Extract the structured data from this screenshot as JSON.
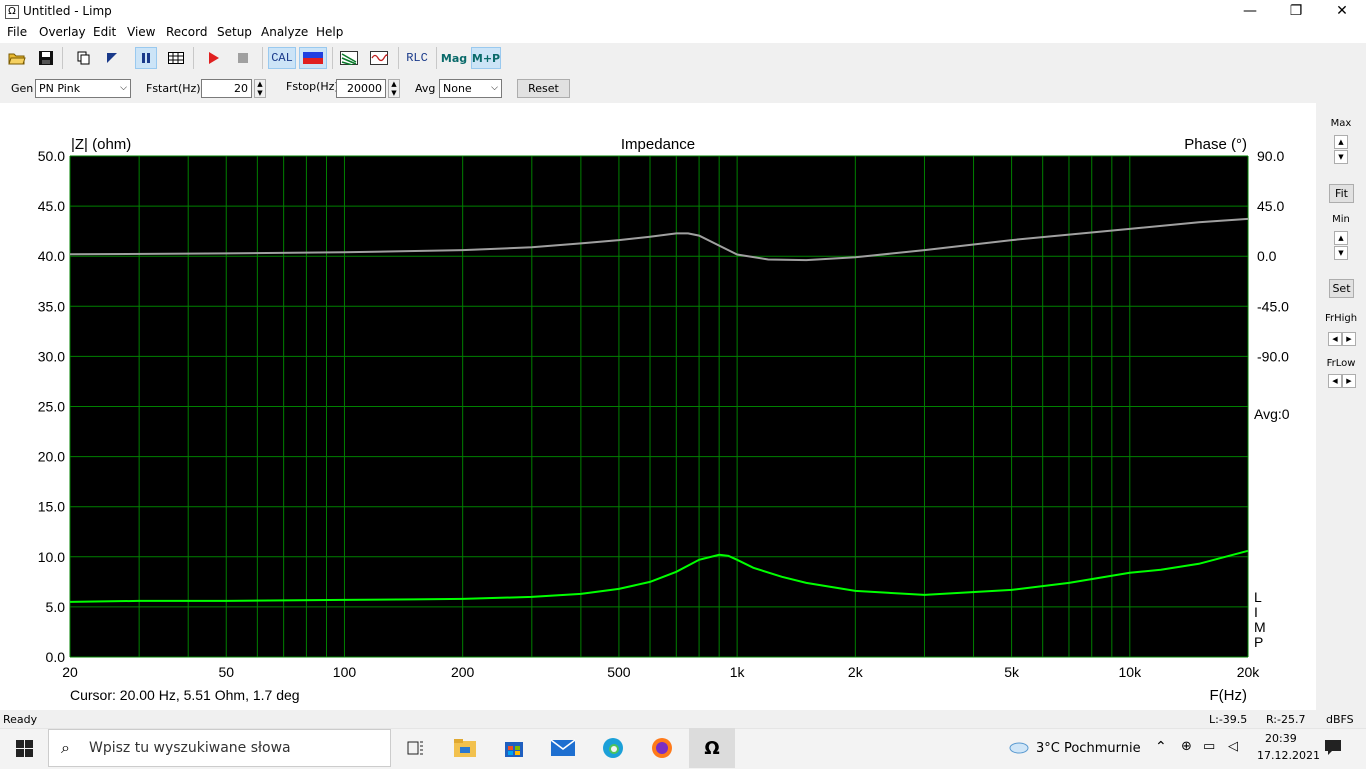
{
  "window": {
    "title": "Untitled - Limp",
    "icon_glyph": "Ω",
    "minimize": "—",
    "maximize": "❐",
    "close": "✕"
  },
  "menu": [
    "File",
    "Overlay",
    "Edit",
    "View",
    "Record",
    "Setup",
    "Analyze",
    "Help"
  ],
  "toolbar": {
    "cal": "CAL",
    "rlc": "RLC",
    "mag": "Mag",
    "mp": "M+P"
  },
  "generator": {
    "gen_label": "Gen",
    "gen_value": "PN Pink",
    "fstart_label": "Fstart(Hz)",
    "fstart_value": "20",
    "fstop_label": "Fstop(Hz)",
    "fstop_value": "20000",
    "avg_label": "Avg",
    "avg_value": "None",
    "reset_label": "Reset"
  },
  "right_panel": {
    "max_label": "Max",
    "fit_label": "Fit",
    "min_label": "Min",
    "set_label": "Set",
    "frhigh_label": "FrHigh",
    "frlow_label": "FrLow"
  },
  "chart_data": {
    "type": "line",
    "title": "Impedance",
    "ylabel": "|Z| (ohm)",
    "y2label": "Phase (°)",
    "xlabel": "F(Hz)",
    "xscale": "log",
    "xlim": [
      20,
      20000
    ],
    "ylim": [
      0,
      50
    ],
    "y2lim": [
      -90,
      90
    ],
    "x_tick_labels": [
      "20",
      "50",
      "100",
      "200",
      "500",
      "1k",
      "2k",
      "5k",
      "10k",
      "20k"
    ],
    "x_tick_values": [
      20,
      50,
      100,
      200,
      500,
      1000,
      2000,
      5000,
      10000,
      20000
    ],
    "y_tick_labels": [
      "50.0",
      "45.0",
      "40.0",
      "35.0",
      "30.0",
      "25.0",
      "20.0",
      "15.0",
      "10.0",
      "5.0",
      "0.0"
    ],
    "y_tick_values": [
      50,
      45,
      40,
      35,
      30,
      25,
      20,
      15,
      10,
      5,
      0
    ],
    "y2_tick_labels": [
      "90.0",
      "45.0",
      "0.0",
      "-45.0",
      "-90.0"
    ],
    "y2_tick_values": [
      90,
      45,
      0,
      -45,
      -90
    ],
    "avg_text": "Avg:0",
    "side_text": [
      "L",
      "I",
      "M",
      "P"
    ],
    "grid": true,
    "colors": {
      "background": "#000000",
      "grid": "#008000",
      "magnitude": "#00ff00",
      "phase": "#a0a0a0"
    },
    "series": [
      {
        "axis": "left",
        "color": "#00ff00",
        "x": [
          20,
          30,
          50,
          100,
          150,
          200,
          300,
          400,
          500,
          600,
          700,
          800,
          900,
          950,
          1000,
          1100,
          1300,
          1500,
          2000,
          3000,
          5000,
          7000,
          10000,
          12000,
          15000,
          20000
        ],
        "y": [
          5.5,
          5.6,
          5.6,
          5.7,
          5.75,
          5.8,
          6.0,
          6.3,
          6.8,
          7.5,
          8.5,
          9.7,
          10.2,
          10.1,
          9.7,
          8.9,
          8.0,
          7.4,
          6.6,
          6.2,
          6.7,
          7.4,
          8.4,
          8.7,
          9.3,
          10.6
        ]
      },
      {
        "axis": "right",
        "color": "#a0a0a0",
        "x": [
          20,
          50,
          100,
          200,
          300,
          400,
          500,
          600,
          700,
          750,
          800,
          900,
          1000,
          1200,
          1500,
          2000,
          3000,
          5000,
          10000,
          15000,
          20000
        ],
        "y": [
          1.7,
          2.5,
          3.5,
          5.5,
          8.0,
          11.5,
          14.5,
          17.5,
          20.5,
          20.5,
          18.5,
          9.5,
          1.5,
          -3.0,
          -3.5,
          -1.0,
          5.5,
          14.5,
          24.5,
          30.5,
          33.5
        ]
      }
    ]
  },
  "cursor": "Cursor: 20.00 Hz, 5.51 Ohm, 1.7 deg",
  "status": {
    "ready": "Ready",
    "l_level": "L:-39.5",
    "r_level": "R:-25.7",
    "dbfs": "dBFS"
  },
  "taskbar": {
    "search_placeholder": "Wpisz tu wyszukiwane słowa",
    "weather": "3°C  Pochmurnie",
    "time": "20:39",
    "date": "17.12.2021"
  }
}
